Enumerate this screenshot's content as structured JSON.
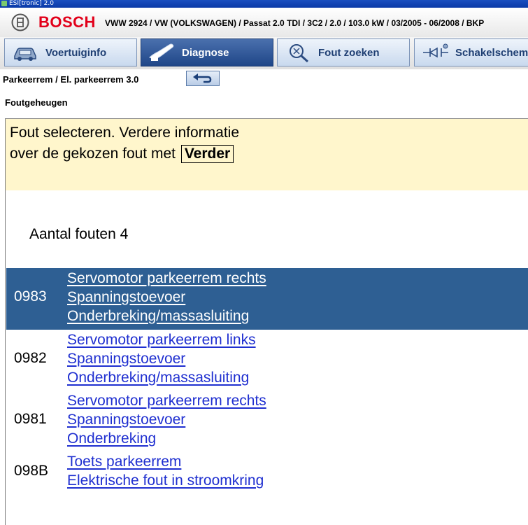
{
  "window": {
    "title": "ESI[tronic] 2.0"
  },
  "header": {
    "brand": "BOSCH",
    "vehicle": "VWW 2924 / VW (VOLKSWAGEN) / Passat 2.0 TDI / 3C2 / 2.0 / 103.0 kW / 03/2005 - 06/2008 / BKP"
  },
  "tabs": [
    {
      "label": "Voertuiginfo",
      "icon": "car-icon"
    },
    {
      "label": "Diagnose",
      "icon": "diagnose-plug-icon",
      "active": true
    },
    {
      "label": "Fout zoeken",
      "icon": "fault-search-icon"
    },
    {
      "label": "Schakelschem",
      "icon": "circuit-diagram-icon"
    }
  ],
  "breadcrumb": "Parkeerrem / El. parkeerrem 3.0",
  "back_icon": "back-arrow-icon",
  "section_title": "Foutgeheugen",
  "info": {
    "line1": "Fout selecteren. Verdere informatie",
    "line2": "over de gekozen fout met",
    "button": "Verder"
  },
  "fault_count": "Aantal fouten 4",
  "faults": [
    {
      "code": "0983",
      "lines": [
        "Servomotor parkeerrem rechts",
        "Spanningstoevoer",
        "Onderbreking/massasluiting"
      ],
      "selected": true
    },
    {
      "code": "0982",
      "lines": [
        "Servomotor parkeerrem links",
        "Spanningstoevoer",
        "Onderbreking/massasluiting"
      ]
    },
    {
      "code": "0981",
      "lines": [
        "Servomotor parkeerrem rechts",
        "Spanningstoevoer",
        "Onderbreking"
      ]
    },
    {
      "code": "098B",
      "lines": [
        "Toets parkeerrem",
        "Elektrische fout in stroomkring"
      ]
    }
  ],
  "colors": {
    "brand_red": "#e2001a",
    "selection": "#2e5f93",
    "info_bg": "#fff6cc",
    "link": "#1f2fd0",
    "active_tab": "#2a5093"
  }
}
